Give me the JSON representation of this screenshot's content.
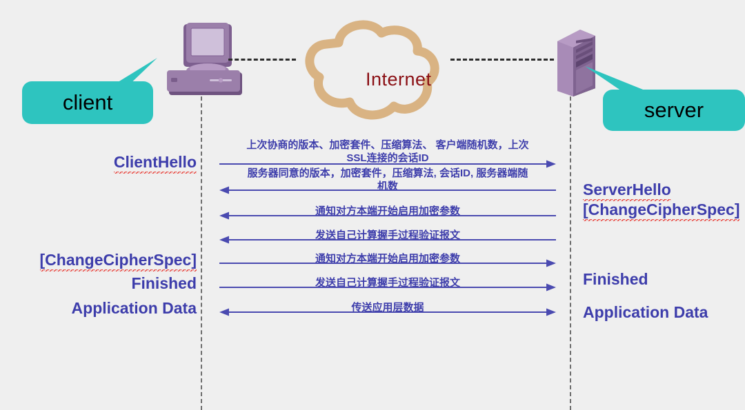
{
  "background_color": "#efefef",
  "accent_colors": {
    "message_blue": "#3d3dab",
    "callout_teal": "#2ec4bf",
    "internet_red": "#8b1015",
    "cloud_tan": "#d9b383",
    "device_purple": "#9b7faa",
    "lifeline_gray": "#6e6e6e",
    "spellcheck_red": "#e8413a"
  },
  "network": {
    "cloud_label": "Internet",
    "cloud_icon": "cloud-icon",
    "link_left_icon": "dashed-link-icon",
    "link_right_icon": "dashed-link-icon"
  },
  "actors": [
    {
      "id": "client",
      "callout_label": "client",
      "icon": "desktop-computer-icon",
      "lifeline_icon": "dash-dot-lifeline-icon"
    },
    {
      "id": "server",
      "callout_label": "server",
      "icon": "server-tower-icon",
      "lifeline_icon": "dash-dot-lifeline-icon"
    }
  ],
  "client_labels": [
    {
      "text": "ClientHello",
      "spellchecked": true
    },
    {
      "text": "[ChangeCipherSpec]",
      "spellchecked": true
    },
    {
      "text": "Finished",
      "spellchecked": false
    },
    {
      "text": "Application Data",
      "spellchecked": false
    }
  ],
  "server_labels": [
    {
      "text": "ServerHello",
      "spellchecked": true
    },
    {
      "text": "[ChangeCipherSpec]",
      "spellchecked": true
    },
    {
      "text": "Finished",
      "spellchecked": false
    },
    {
      "text": "Application Data",
      "spellchecked": false
    }
  ],
  "messages": [
    {
      "index": 1,
      "caption": "上次协商的版本、加密套件、压缩算法、 客户端随机数，上次\nSSL连接的会话ID",
      "direction": "client-to-server",
      "arrow_icon": "arrow-right-icon"
    },
    {
      "index": 2,
      "caption": "服务器同意的版本，加密套件，压缩算法, 会话ID, 服务器端随\n机数",
      "direction": "server-to-client",
      "arrow_icon": "arrow-left-icon"
    },
    {
      "index": 3,
      "caption": "通知对方本端开始启用加密参数",
      "direction": "server-to-client",
      "arrow_icon": "arrow-left-icon"
    },
    {
      "index": 4,
      "caption": "发送自己计算握手过程验证报文",
      "direction": "server-to-client",
      "arrow_icon": "arrow-left-icon"
    },
    {
      "index": 5,
      "caption": "通知对方本端开始启用加密参数",
      "direction": "client-to-server",
      "arrow_icon": "arrow-right-icon"
    },
    {
      "index": 6,
      "caption": "发送自己计算握手过程验证报文",
      "direction": "client-to-server",
      "arrow_icon": "arrow-right-icon"
    },
    {
      "index": 7,
      "caption": "传送应用层数据",
      "direction": "bidirectional",
      "arrow_icon": "arrow-both-icon"
    }
  ]
}
